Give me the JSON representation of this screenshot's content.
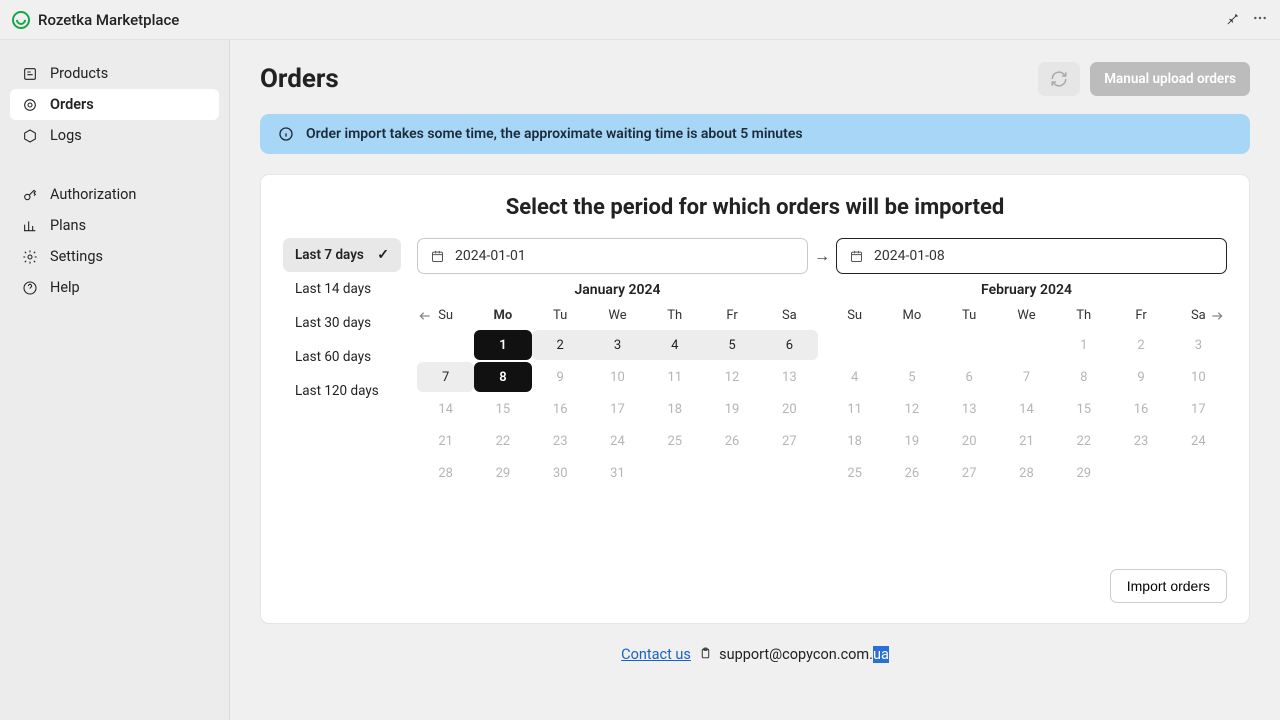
{
  "app": {
    "title": "Rozetka Marketplace"
  },
  "sidebar": {
    "group1": [
      {
        "label": "Products"
      },
      {
        "label": "Orders"
      },
      {
        "label": "Logs"
      }
    ],
    "group2": [
      {
        "label": "Authorization"
      },
      {
        "label": "Plans"
      },
      {
        "label": "Settings"
      },
      {
        "label": "Help"
      }
    ]
  },
  "page": {
    "title": "Orders",
    "upload_label": "Manual upload orders",
    "banner": "Order import takes some time, the approximate waiting time is about 5 minutes",
    "card_title": "Select the period for which orders will be imported",
    "import_btn": "Import orders"
  },
  "presets": [
    "Last 7 days",
    "Last 14 days",
    "Last 30 days",
    "Last 60 days",
    "Last 120 days"
  ],
  "range": {
    "from": "2024-01-01",
    "to": "2024-01-08"
  },
  "dow": [
    "Su",
    "Mo",
    "Tu",
    "We",
    "Th",
    "Fr",
    "Sa"
  ],
  "months": {
    "left": {
      "title": "January 2024",
      "weeks": [
        [
          "",
          "1",
          "2",
          "3",
          "4",
          "5",
          "6"
        ],
        [
          "7",
          "8",
          "9",
          "10",
          "11",
          "12",
          "13"
        ],
        [
          "14",
          "15",
          "16",
          "17",
          "18",
          "19",
          "20"
        ],
        [
          "21",
          "22",
          "23",
          "24",
          "25",
          "26",
          "27"
        ],
        [
          "28",
          "29",
          "30",
          "31",
          "",
          "",
          ""
        ]
      ]
    },
    "right": {
      "title": "February 2024",
      "weeks": [
        [
          "",
          "",
          "",
          "",
          "1",
          "2",
          "3"
        ],
        [
          "4",
          "5",
          "6",
          "7",
          "8",
          "9",
          "10"
        ],
        [
          "11",
          "12",
          "13",
          "14",
          "15",
          "16",
          "17"
        ],
        [
          "18",
          "19",
          "20",
          "21",
          "22",
          "23",
          "24"
        ],
        [
          "25",
          "26",
          "27",
          "28",
          "29",
          "",
          ""
        ]
      ]
    }
  },
  "footer": {
    "contact": "Contact us",
    "email_prefix": "support@copycon.com.",
    "email_sel": "ua"
  }
}
